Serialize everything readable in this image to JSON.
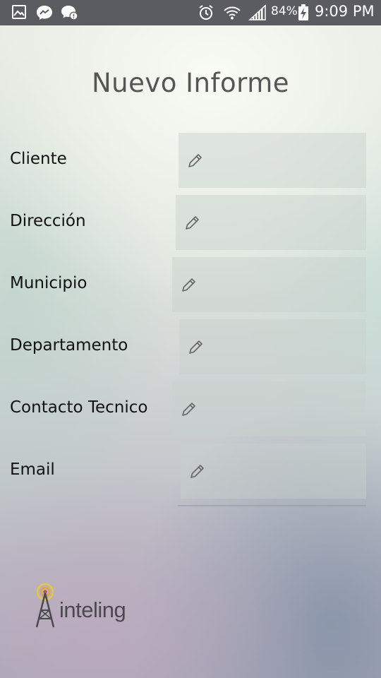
{
  "status_bar": {
    "battery_percent": "84%",
    "time": "9:09 PM",
    "icons": [
      "gallery-icon",
      "messenger-icon",
      "chat-alert-icon",
      "alarm-icon",
      "wifi-icon",
      "signal-icon",
      "battery-charging-icon"
    ]
  },
  "title": "Nuevo Informe",
  "fields": [
    {
      "label": "Cliente",
      "value": ""
    },
    {
      "label": "Dirección",
      "value": ""
    },
    {
      "label": "Municipio",
      "value": ""
    },
    {
      "label": "Departamento",
      "value": ""
    },
    {
      "label": "Contacto Tecnico",
      "value": ""
    },
    {
      "label": "Email",
      "value": ""
    }
  ],
  "logo": {
    "text": "inteling",
    "icon": "antenna-tower-icon"
  },
  "colors": {
    "status_bar": "#5a5c62",
    "title": "#555555",
    "label": "#111111",
    "logo_accent": "#e8c64a"
  }
}
